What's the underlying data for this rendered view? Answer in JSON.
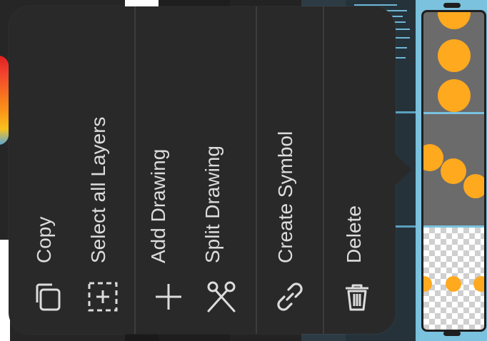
{
  "context_menu": {
    "items": [
      {
        "label": "Copy",
        "icon": "copy-icon"
      },
      {
        "label": "Select all Layers",
        "icon": "select-all-icon"
      },
      {
        "label": "Add Drawing",
        "icon": "plus-icon"
      },
      {
        "label": "Split Drawing",
        "icon": "scissors-icon"
      },
      {
        "label": "Create Symbol",
        "icon": "link-icon"
      },
      {
        "label": "Delete",
        "icon": "trash-icon"
      }
    ]
  },
  "colors": {
    "menu_bg": "#292929",
    "menu_text": "#dcdcdc",
    "accent": "#ffa91f",
    "panel": "#7ac2de"
  }
}
